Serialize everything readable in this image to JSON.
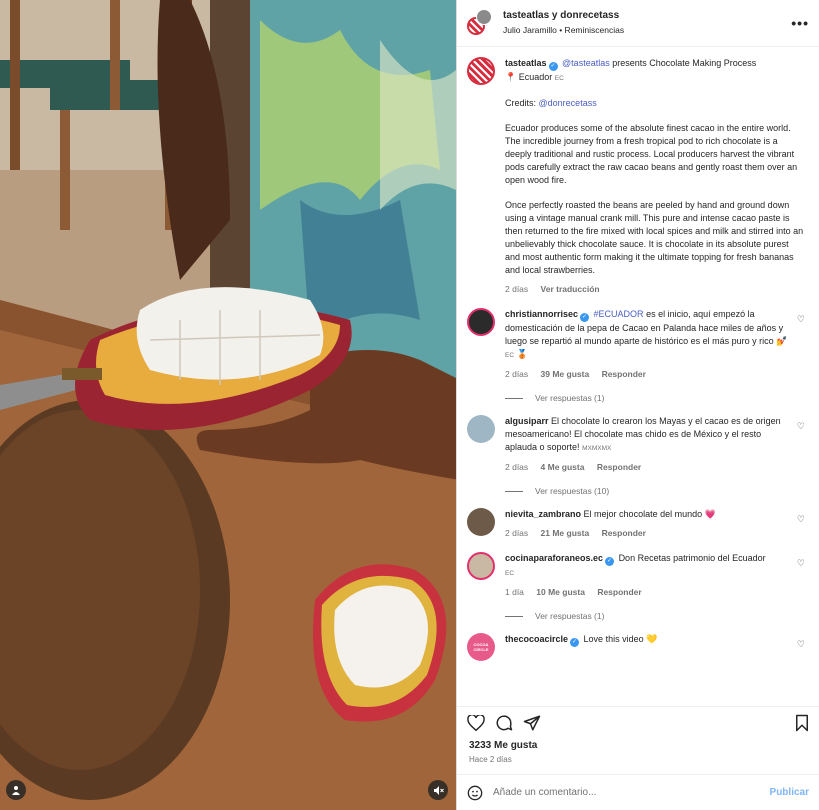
{
  "header": {
    "title": "tasteatlas y donrecetass",
    "subtitle": "Julio Jaramillo • Reminiscencias",
    "more_label": "•••"
  },
  "caption": {
    "username": "tasteatlas",
    "mention": "@tasteatlas",
    "intro": "presents Chocolate Making Process",
    "location": "📍 Ecuador",
    "location_flag": "EC",
    "credits_label": "Credits:",
    "credits_handle": "@donrecetass",
    "paragraph1": "Ecuador produces some of the absolute finest cacao in the entire world. The incredible journey from a fresh tropical pod to rich chocolate is a deeply traditional and rustic process. Local producers harvest the vibrant pods carefully extract the raw cacao beans and gently roast them over an open wood fire.",
    "paragraph2": "Once perfectly roasted the beans are peeled by hand and ground down using a vintage manual crank mill. This pure and intense cacao paste is then returned to the fire mixed with local spices and milk and stirred into an unbelievably thick chocolate sauce. It is chocolate in its absolute purest and most authentic form making it the ultimate topping for fresh bananas and local strawberries.",
    "time": "2 días",
    "translate": "Ver traducción"
  },
  "comments": [
    {
      "username": "christiannorrisec",
      "hashtag": "#ECUADOR",
      "text": "es el inicio, aquí empezó la domesticación de la pepa de Cacao en Palanda hace miles de años y luego se repartió al mundo aparte de histórico es el más puro y rico 💅",
      "flag": "EC",
      "emoji_end": "🥉",
      "time": "2 días",
      "likes": "39 Me gusta",
      "reply": "Responder",
      "view_replies": "Ver respuestas (1)"
    },
    {
      "username": "algusiparr",
      "text": "El chocolate lo crearon los Mayas y el cacao es de origen mesoamericano! El chocolate mas chido es de México y el resto aplauda o soporte!",
      "flag": "MXMXMX",
      "time": "2 días",
      "likes": "4 Me gusta",
      "reply": "Responder",
      "view_replies": "Ver respuestas (10)"
    },
    {
      "username": "nievita_zambrano",
      "text": "El mejor chocolate del mundo 💗",
      "time": "2 días",
      "likes": "21 Me gusta",
      "reply": "Responder"
    },
    {
      "username": "cocinaparaforaneos.ec",
      "text": "Don Recetas patrimonio del Ecuador",
      "flag": "EC",
      "time": "1 día",
      "likes": "10 Me gusta",
      "reply": "Responder",
      "view_replies": "Ver respuestas (1)"
    },
    {
      "username": "thecocoacircle",
      "text": "Love this video 💛",
      "avatar_text": "COCOA CIRCLE"
    }
  ],
  "footer": {
    "likes": "3233 Me gusta",
    "posted": "Hace 2 días",
    "comment_placeholder": "Añade un comentario...",
    "post_label": "Publicar"
  },
  "colors": {
    "accent": "#0095f6",
    "brand_red": "#d62d3f",
    "post_disabled": "#7fb6f4"
  }
}
